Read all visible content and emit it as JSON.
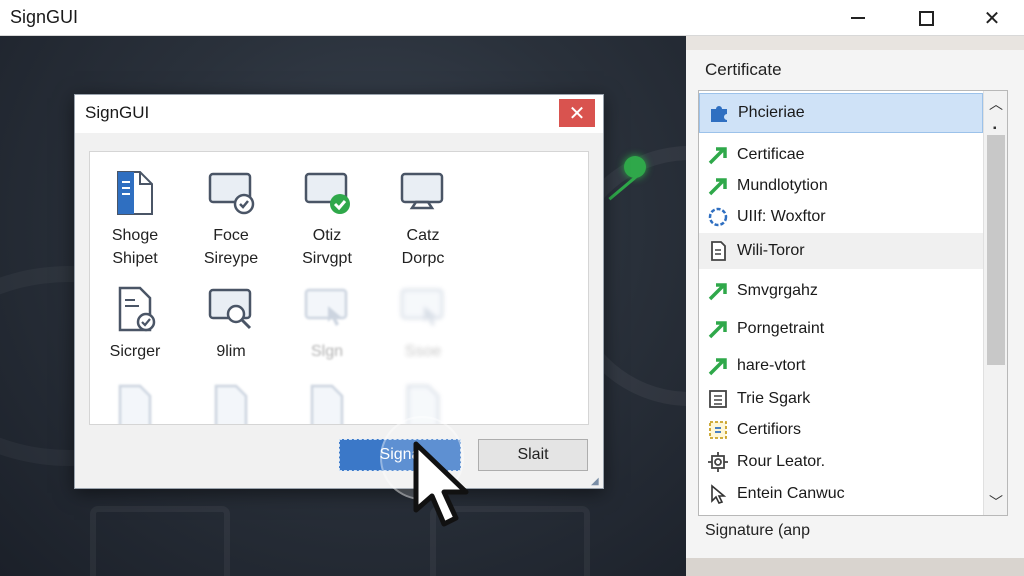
{
  "window": {
    "title": "SignGUI",
    "minimize_icon": "minimize-icon",
    "maximize_icon": "maximize-icon",
    "close_label": "✕"
  },
  "dialog": {
    "title": "SignGUI",
    "close_label": "✕",
    "tiles": [
      {
        "line1": "Shoge",
        "line2": "Shipet",
        "icon": "document-icon"
      },
      {
        "line1": "Foce",
        "line2": "Sireype",
        "icon": "monitor-check-icon"
      },
      {
        "line1": "Otiz",
        "line2": "Sirvgpt",
        "icon": "monitor-green-check-icon"
      },
      {
        "line1": "Catz",
        "line2": "Dorpc",
        "icon": "monitor-tray-icon"
      },
      {
        "line1": "Sicrger",
        "line2": "",
        "icon": "document-check-icon"
      },
      {
        "line1": "9lim",
        "line2": "",
        "icon": "monitor-search-icon"
      },
      {
        "line1": "Slgn",
        "line2": "",
        "icon": "monitor-cursor-icon"
      },
      {
        "line1": "Ssoe",
        "line2": "",
        "icon": "monitor-cursor-icon"
      }
    ],
    "sign_button": "Signa",
    "start_button": "Slait"
  },
  "certificate_panel": {
    "header": "Certificate",
    "items": [
      {
        "label": "Phcieriae",
        "icon": "puzzle-icon",
        "selected": true
      },
      {
        "label": "Certificae",
        "icon": "green-arrow-icon"
      },
      {
        "label": "Mundlotytion",
        "icon": "green-arrow-icon"
      },
      {
        "label": "UIIf: Woxftor",
        "icon": "dashed-circle-icon"
      },
      {
        "label": "Wili-Toror",
        "icon": "file-icon",
        "hover": true
      },
      {
        "label": "Smvgrgahz",
        "icon": "green-arrow-icon"
      },
      {
        "label": "Porngetraint",
        "icon": "green-arrow-icon"
      },
      {
        "label": "hare-vtort",
        "icon": "green-arrow-icon"
      },
      {
        "label": "Trie Sgark",
        "icon": "list-icon"
      },
      {
        "label": "Certifiors",
        "icon": "badge-icon"
      },
      {
        "label": "Rour Leator.",
        "icon": "gear-icon"
      },
      {
        "label": "Entein Canwuc",
        "icon": "cursor-icon"
      }
    ],
    "footer": "Signature (anp"
  },
  "colors": {
    "accent": "#3b78c8",
    "close_red": "#d9534f",
    "green": "#2fa84a"
  }
}
